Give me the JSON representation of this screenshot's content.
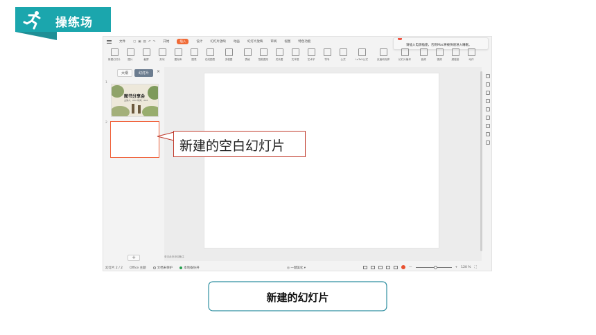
{
  "banner": {
    "title": "操练场",
    "icon": "runner-icon",
    "color": "#1ba6ad"
  },
  "app": {
    "menubar": {
      "file": "文件",
      "tabs": [
        "开始",
        "插入",
        "设计",
        "幻灯片放映",
        "动画",
        "幻灯片放映",
        "审阅",
        "视图",
        "特色功能"
      ],
      "active_tab": "插入"
    },
    "notice": "请插入电源插座，否则Mac将被快速进入睡眠。",
    "ribbon": {
      "items": [
        "新建幻灯片",
        "图片",
        "截屏",
        "形状",
        "图标库",
        "图表",
        "在线图表",
        "流程图",
        "思维导图",
        "表格",
        "智能图形",
        "关系图",
        "文本框",
        "艺术字",
        "符号",
        "公式",
        "LaTeX公式",
        "页眉和页脚",
        "日期",
        "幻灯片编号",
        "对象",
        "附件",
        "音频",
        "视频",
        "超链接",
        "动作"
      ]
    },
    "left_pane": {
      "tab_outline": "大纲",
      "tab_slides": "幻灯片",
      "close": "×",
      "slide1_num": "1",
      "slide2_num": "2",
      "slide1_title": "图书分享会",
      "slide1_sub": "主讲人：XXX  时间：XXX",
      "add": "+"
    },
    "notes_hint": "单击此处添加备注",
    "status": {
      "slide_info": "幻灯片 2 / 2",
      "theme": "Office 主题",
      "protect": "文档未保护",
      "backup": "本地备份开",
      "beautify": "一键美化",
      "zoom": "120 %",
      "accent": "#f06a36"
    }
  },
  "callout": {
    "text": "新建的空白幻灯片",
    "border": "#c0392b"
  },
  "caption": {
    "text": "新建的幻灯片",
    "border": "#2f8fa0"
  }
}
